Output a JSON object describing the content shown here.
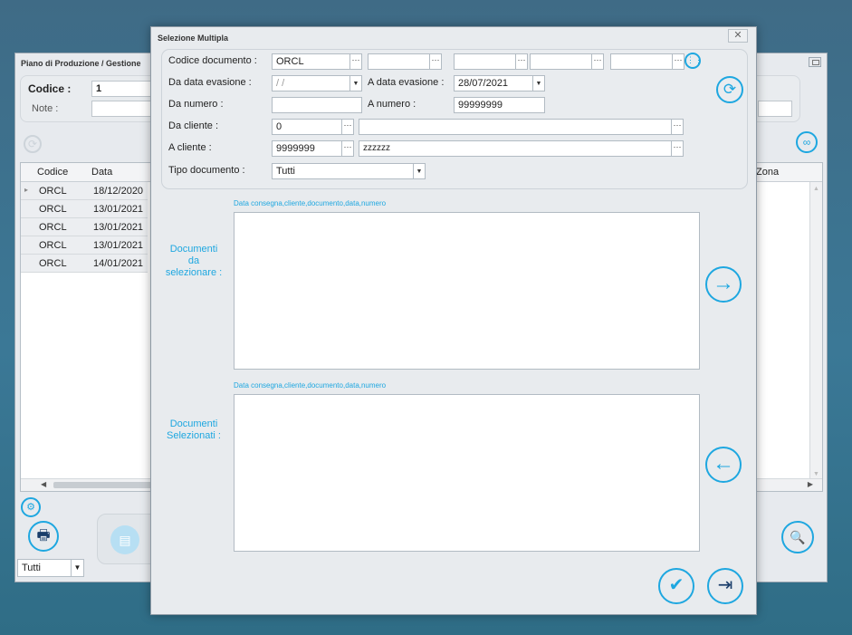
{
  "background_window": {
    "title": "Piano di Produzione / Gestione",
    "codice_label": "Codice :",
    "codice_value": "1",
    "note_label": "Note :",
    "grid_headers": [
      "Codice",
      "Data",
      "Zona"
    ],
    "grid_rows": [
      {
        "codice": "ORCL",
        "data": "18/12/2020"
      },
      {
        "codice": "ORCL",
        "data": "13/01/2021"
      },
      {
        "codice": "ORCL",
        "data": "13/01/2021"
      },
      {
        "codice": "ORCL",
        "data": "13/01/2021"
      },
      {
        "codice": "ORCL",
        "data": "14/01/2021"
      }
    ],
    "filter_value": "Tutti"
  },
  "dialog": {
    "title": "Selezione Multipla",
    "close_glyph": "✕",
    "filters": {
      "codice_documento_label": "Codice documento :",
      "codice_documento_value": "ORCL",
      "da_data_evasione_label": "Da data evasione :",
      "da_data_evasione_value": " /  /",
      "a_data_evasione_label": "A data evasione :",
      "a_data_evasione_value": "28/07/2021",
      "da_numero_label": "Da numero :",
      "da_numero_value": "",
      "a_numero_label": "A numero :",
      "a_numero_value": "99999999",
      "da_cliente_label": "Da cliente :",
      "da_cliente_value": "0",
      "da_cliente_desc": "",
      "a_cliente_label": "A cliente :",
      "a_cliente_value": "9999999",
      "a_cliente_desc": "zzzzzz",
      "tipo_documento_label": "Tipo documento :",
      "tipo_documento_value": "Tutti"
    },
    "list_hint_1": "Data consegna,cliente,documento,data,numero",
    "list_hint_2": "Data consegna,cliente,documento,data,numero",
    "documenti_da_selezionare": [
      "Documenti",
      "da",
      "selezionare :"
    ],
    "documenti_selezionati": [
      "Documenti",
      "Selezionati :"
    ]
  },
  "icons": {
    "ellipsis": "···",
    "dropdown": "▼",
    "refresh": "⟳",
    "arrow_right": "→",
    "arrow_left": "←",
    "check": "✔",
    "exit": "⇥",
    "grid_dots": "⋮⋮",
    "gear": "⚙",
    "printer": "🖶",
    "link": "∞",
    "search_doc": "🔍",
    "row_pointer": "▸",
    "scroll_left": "◀",
    "scroll_right": "▶",
    "scroll_up": "▲",
    "scroll_down": "▼"
  },
  "colors": {
    "accent": "#1ea7e0",
    "dialog_bg": "#e8ebee",
    "desktop_bg": "#3b7896"
  }
}
